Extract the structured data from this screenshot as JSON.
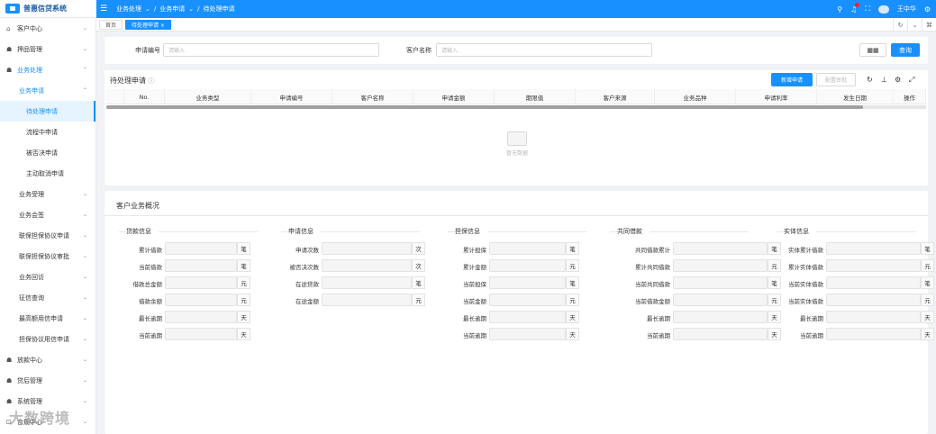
{
  "app": {
    "title": "普惠信贷系统"
  },
  "header": {
    "breadcrumb": [
      "业务处理",
      "业务申请",
      "待处理申请"
    ],
    "user": "王中华"
  },
  "sidebar": {
    "items": [
      {
        "label": "客户中心",
        "level": 0,
        "arrow": "⌄"
      },
      {
        "label": "押品管理",
        "level": 0,
        "arrow": "⌄"
      },
      {
        "label": "业务处理",
        "level": 0,
        "arrow": "⌃",
        "open": true
      },
      {
        "label": "业务申请",
        "level": 1,
        "arrow": "⌃",
        "open": true
      },
      {
        "label": "待处理申请",
        "level": 2,
        "active": true
      },
      {
        "label": "流程中申请",
        "level": 2
      },
      {
        "label": "被否决申请",
        "level": 2
      },
      {
        "label": "主动取消申请",
        "level": 2
      },
      {
        "label": "业务受理",
        "level": 1,
        "arrow": "⌄"
      },
      {
        "label": "业务会签",
        "level": 1,
        "arrow": "⌄"
      },
      {
        "label": "联保担保协议申请",
        "level": 1,
        "arrow": "⌄"
      },
      {
        "label": "联保担保协议审批",
        "level": 1,
        "arrow": "⌄"
      },
      {
        "label": "业务回访",
        "level": 1,
        "arrow": "⌄"
      },
      {
        "label": "征信查询",
        "level": 1,
        "arrow": "⌄"
      },
      {
        "label": "最高额用信申请",
        "level": 1,
        "arrow": "⌄"
      },
      {
        "label": "担保协议用信申请",
        "level": 1,
        "arrow": "⌄"
      },
      {
        "label": "放款中心",
        "level": 0,
        "arrow": "⌄"
      },
      {
        "label": "贷后管理",
        "level": 0,
        "arrow": "⌄"
      },
      {
        "label": "系统管理",
        "level": 0,
        "arrow": "⌄"
      },
      {
        "label": "合规中心",
        "level": 0,
        "arrow": "⌄"
      }
    ]
  },
  "tabs": [
    {
      "label": "首页"
    },
    {
      "label": "待处理申请 ×",
      "active": true
    }
  ],
  "search": {
    "label1": "申请编号",
    "placeholder1": "请输入",
    "label2": "客户名称",
    "placeholder2": "请输入",
    "query": "查询"
  },
  "table": {
    "title": "待处理申请",
    "new_btn": "新增申请",
    "config_btn": "配置审批",
    "columns": [
      "",
      "No.",
      "业务类型",
      "申请编号",
      "客户名称",
      "申请金额",
      "期限值",
      "客户来源",
      "业务品种",
      "申请利率",
      "发生日期",
      "操作"
    ],
    "empty": "暂无数据"
  },
  "overview": {
    "title": "客户业务概况",
    "sections": [
      {
        "title": "贷款信息",
        "rows": [
          {
            "label": "累计借款",
            "unit": "笔"
          },
          {
            "label": "当前借款",
            "unit": "笔"
          },
          {
            "label": "借款总金额",
            "unit": "元"
          },
          {
            "label": "借款余额",
            "unit": "元"
          },
          {
            "label": "最长逾期",
            "unit": "天"
          },
          {
            "label": "当前逾期",
            "unit": "天"
          }
        ]
      },
      {
        "title": "申请信息",
        "rows": [
          {
            "label": "申请次数",
            "unit": "次"
          },
          {
            "label": "被否决次数",
            "unit": "次"
          },
          {
            "label": "在途贷款",
            "unit": "笔"
          },
          {
            "label": "在途金额",
            "unit": "元"
          }
        ]
      },
      {
        "title": "担保信息",
        "rows": [
          {
            "label": "累计担保",
            "unit": "笔"
          },
          {
            "label": "累计金额",
            "unit": "元"
          },
          {
            "label": "当前担保",
            "unit": "笔"
          },
          {
            "label": "当前金额",
            "unit": "元"
          },
          {
            "label": "最长逾期",
            "unit": "天"
          },
          {
            "label": "当前逾期",
            "unit": "天"
          }
        ]
      },
      {
        "title": "共同借款",
        "rows": [
          {
            "label": "共同借款累计",
            "unit": "笔"
          },
          {
            "label": "累计共同借款",
            "unit": "元"
          },
          {
            "label": "当前共同借款",
            "unit": "笔"
          },
          {
            "label": "当前借款金额",
            "unit": "元"
          },
          {
            "label": "最长逾期",
            "unit": "天"
          },
          {
            "label": "当前逾期",
            "unit": "天"
          }
        ]
      },
      {
        "title": "实体信息",
        "rows": [
          {
            "label": "实体累计借款",
            "unit": "笔"
          },
          {
            "label": "累计实体借款",
            "unit": "元"
          },
          {
            "label": "当前实体借款",
            "unit": "笔"
          },
          {
            "label": "当前实体借款",
            "unit": "元"
          },
          {
            "label": "最长逾期",
            "unit": "天"
          },
          {
            "label": "当前逾期",
            "unit": "天"
          }
        ]
      }
    ]
  },
  "watermark": "大数跨境"
}
